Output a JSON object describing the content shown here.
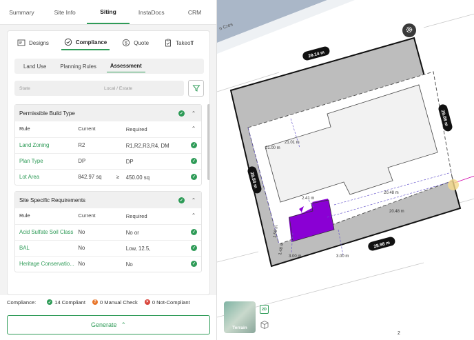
{
  "top_tabs": [
    "Summary",
    "Site Info",
    "Siting",
    "InstaDocs",
    "CRM"
  ],
  "active_top_tab": "Siting",
  "sub_tabs": [
    {
      "label": "Designs",
      "icon": "designs-icon"
    },
    {
      "label": "Compliance",
      "icon": "check-circle-icon"
    },
    {
      "label": "Quote",
      "icon": "dollar-icon"
    },
    {
      "label": "Takeoff",
      "icon": "clipboard-icon"
    }
  ],
  "segments": [
    "Land Use",
    "Planning Rules",
    "Assessment"
  ],
  "filters": {
    "state_placeholder": "State",
    "local_placeholder": "Local / Estate"
  },
  "table_headers": {
    "rule": "Rule",
    "current": "Current",
    "required": "Required"
  },
  "sections": [
    {
      "title": "Permissible Build Type",
      "rows": [
        {
          "rule": "Land Zoning",
          "current": "R2",
          "symbol": "",
          "required": "R1,R2,R3,R4, DM"
        },
        {
          "rule": "Plan Type",
          "current": "DP",
          "symbol": "",
          "required": "DP"
        },
        {
          "rule": "Lot Area",
          "current": "842.97 sq",
          "symbol": "≥",
          "required": "450.00 sq"
        }
      ]
    },
    {
      "title": "Site Specific Requirements",
      "rows": [
        {
          "rule": "Acid Sulfate Soil Class",
          "current": "No",
          "symbol": "",
          "required": "No or"
        },
        {
          "rule": "BAL",
          "current": "No",
          "symbol": "",
          "required": "Low, 12.5,"
        },
        {
          "rule": "Heritage Conservatio...",
          "current": "No",
          "symbol": "",
          "required": "No"
        }
      ]
    }
  ],
  "summary": {
    "label": "Compliance:",
    "compliant": "14 Compliant",
    "manual": "0 Manual Check",
    "not_compliant": "0 Not-Compliant"
  },
  "generate_label": "Generate",
  "map": {
    "street_label": "n Cres",
    "dims": {
      "top": "29.14 m",
      "right": "29.08 m",
      "left": "28.93 m",
      "bottom": "28.98 m",
      "inner_a": "21.01 m",
      "inner_b": "21.00 m",
      "inner_c": "20.48 m",
      "inner_d": "20.48 m",
      "inner_e": "2.41 m",
      "inner_f": "1.50 m",
      "inner_g": "1.48 m",
      "inner_h": "3.00 m",
      "inner_i": "3.00 m"
    },
    "terrain_label": "Terrain",
    "view_badge": "2D",
    "page_number": "2"
  },
  "colors": {
    "accent": "#2e9b57",
    "purple": "#8a00d4",
    "lot_gray": "#bdbdbd"
  }
}
